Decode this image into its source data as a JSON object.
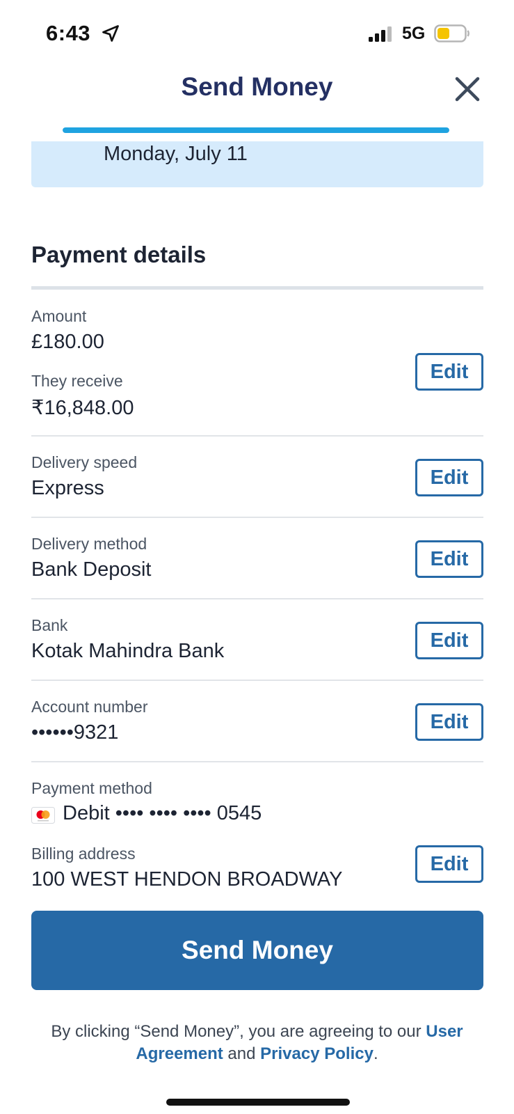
{
  "status_bar": {
    "time": "6:43",
    "network": "5G",
    "battery_color": "#f5c400"
  },
  "header": {
    "title": "Send Money",
    "progress_fraction": 1.0
  },
  "date_banner": {
    "text": "Monday, July 11"
  },
  "payment_details": {
    "title": "Payment details",
    "amount_label": "Amount",
    "amount_value": "£180.00",
    "receive_label": "They receive",
    "receive_value": "₹16,848.00",
    "speed_label": "Delivery speed",
    "speed_value": "Express",
    "method_label": "Delivery method",
    "method_value": "Bank Deposit",
    "bank_label": "Bank",
    "bank_value": "Kotak Mahindra Bank",
    "account_label": "Account number",
    "account_value": "••••••9321",
    "payment_label": "Payment method",
    "payment_value": "Debit •••• •••• •••• 0545",
    "billing_label": "Billing address",
    "billing_value": "100 WEST HENDON BROADWAY",
    "edit_label": "Edit"
  },
  "actions": {
    "send_label": "Send Money"
  },
  "legal": {
    "prefix": "By clicking “Send Money”, you are agreeing to our ",
    "user_agreement": "User Agreement",
    "and": " and ",
    "privacy_policy": "Privacy Policy",
    "suffix": "."
  },
  "colors": {
    "accent": "#2669a6",
    "title": "#243063",
    "progress": "#1fa3e0",
    "banner": "#d6ebfc"
  },
  "icons": [
    "location-arrow-icon",
    "signal-icon",
    "battery-icon",
    "close-icon",
    "mastercard-icon"
  ]
}
